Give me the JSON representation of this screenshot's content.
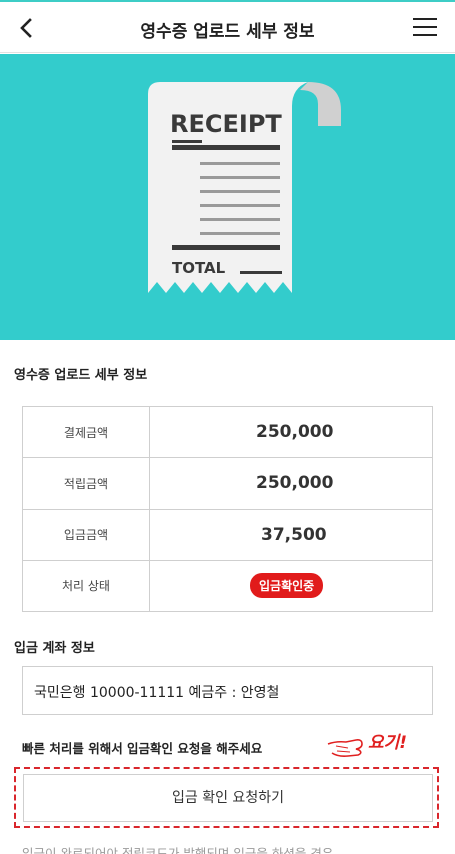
{
  "header": {
    "title": "영수증 업로드 세부 정보"
  },
  "hero": {
    "receipt_title": "RECEIPT",
    "receipt_total": "TOTAL",
    "background_color": "#33cccc"
  },
  "details": {
    "section_title": "영수증 업로드 세부 정보",
    "rows": [
      {
        "label": "결제금액",
        "value": "250,000"
      },
      {
        "label": "적립금액",
        "value": "250,000"
      },
      {
        "label": "입금금액",
        "value": "37,500"
      }
    ],
    "status_label": "처리 상태",
    "status_value": "입금확인중",
    "status_color": "#e11b1b"
  },
  "account": {
    "section_title": "입금 계좌 정보",
    "text": "국민은행 10000-11111 예금주 : 안영철"
  },
  "notice": {
    "text": "빠른 처리를 위해서 입금확인 요청을 해주세요",
    "annotation": "요기!"
  },
  "request_button": {
    "label": "입금 확인 요청하기"
  },
  "footnote": {
    "text": "입금이 완료되어야 적립코드가 발행되며 입금을 하셨을 경우"
  }
}
